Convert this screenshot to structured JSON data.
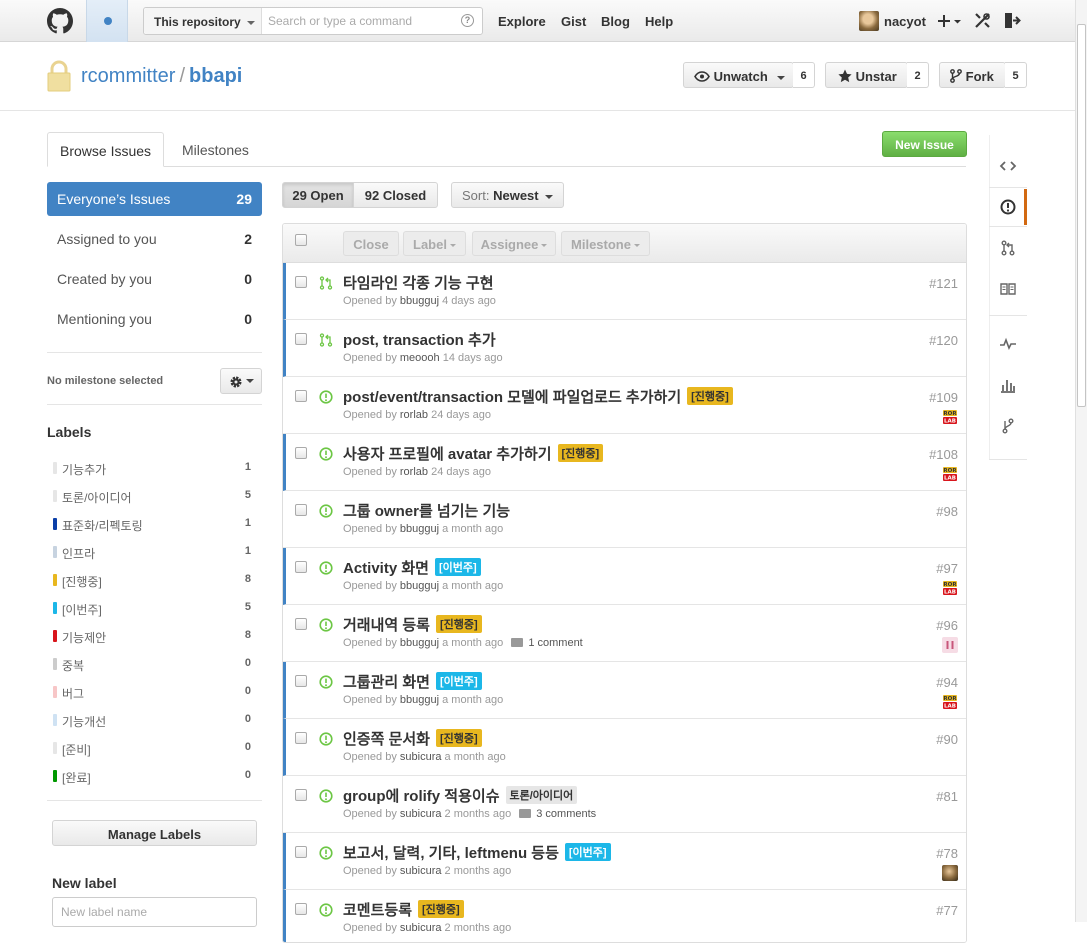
{
  "header": {
    "search_scope": "This repository",
    "search_placeholder": "Search or type a command",
    "nav": [
      "Explore",
      "Gist",
      "Blog",
      "Help"
    ],
    "username": "nacyot"
  },
  "repo": {
    "owner": "rcommitter",
    "name": "bbapi",
    "watch": {
      "label": "Unwatch",
      "count": "6"
    },
    "star": {
      "label": "Unstar",
      "count": "2"
    },
    "fork": {
      "label": "Fork",
      "count": "5"
    }
  },
  "tabs": {
    "browse": "Browse Issues",
    "milestones": "Milestones"
  },
  "new_issue": "New Issue",
  "filters": [
    {
      "label": "Everyone’s Issues",
      "count": "29"
    },
    {
      "label": "Assigned to you",
      "count": "2"
    },
    {
      "label": "Created by you",
      "count": "0"
    },
    {
      "label": "Mentioning you",
      "count": "0"
    }
  ],
  "milestone": {
    "label": "No milestone selected"
  },
  "labels": {
    "heading": "Labels",
    "items": [
      {
        "name": "기능추가",
        "count": "1",
        "color": "#e6e6e6"
      },
      {
        "name": "토론/아이디어",
        "count": "5",
        "color": "#e6e6e6"
      },
      {
        "name": "표준화/리펙토링",
        "count": "1",
        "color": "#0b3fa8"
      },
      {
        "name": "인프라",
        "count": "1",
        "color": "#c7d3e0"
      },
      {
        "name": "[진행중]",
        "count": "8",
        "color": "#e8b71f"
      },
      {
        "name": "[이번주]",
        "count": "5",
        "color": "#1cb7e8"
      },
      {
        "name": "기능제안",
        "count": "8",
        "color": "#d8151c"
      },
      {
        "name": "중복",
        "count": "0",
        "color": "#cccccc"
      },
      {
        "name": "버그",
        "count": "0",
        "color": "#f7c6c7"
      },
      {
        "name": "기능개선",
        "count": "0",
        "color": "#cfe2f3"
      },
      {
        "name": "[준비]",
        "count": "0",
        "color": "#e6e6e6"
      },
      {
        "name": "[완료]",
        "count": "0",
        "color": "#009800"
      }
    ],
    "manage": "Manage Labels",
    "new_label_heading": "New label",
    "new_label_placeholder": "New label name"
  },
  "list": {
    "open": "29 Open",
    "closed": "92 Closed",
    "sort_prefix": "Sort:",
    "sort_value": "Newest",
    "toolbar": [
      "Close",
      "Label",
      "Assignee",
      "Milestone"
    ],
    "opened_by": "Opened by"
  },
  "issues": [
    {
      "title": "타임라인 각종 기능 구현",
      "num": "#121",
      "author": "bbugguj",
      "ago": "4 days ago",
      "type": "pr",
      "bar": true,
      "tag": "",
      "tag_color": "",
      "comments": "",
      "milestone": ""
    },
    {
      "title": "post, transaction 추가",
      "num": "#120",
      "author": "meoooh",
      "ago": "14 days ago",
      "type": "pr",
      "bar": true,
      "tag": "",
      "tag_color": "",
      "comments": "",
      "milestone": ""
    },
    {
      "title": "post/event/transaction 모델에 파일업로드 추가하기",
      "num": "#109",
      "author": "rorlab",
      "ago": "24 days ago",
      "type": "issue",
      "bar": false,
      "tag": "[진행중]",
      "tag_color": "y",
      "comments": "",
      "milestone": "ROR LAB"
    },
    {
      "title": "사용자 프로필에 avatar 추가하기",
      "num": "#108",
      "author": "rorlab",
      "ago": "24 days ago",
      "type": "issue",
      "bar": true,
      "tag": "[진행중]",
      "tag_color": "y",
      "comments": "",
      "milestone": "ROR LAB"
    },
    {
      "title": "그룹 owner를 넘기는 기능",
      "num": "#98",
      "author": "bbugguj",
      "ago": "a month ago",
      "type": "issue",
      "bar": false,
      "tag": "",
      "tag_color": "",
      "comments": "",
      "milestone": ""
    },
    {
      "title": "Activity 화면",
      "num": "#97",
      "author": "bbugguj",
      "ago": "a month ago",
      "type": "issue",
      "bar": true,
      "tag": "[이번주]",
      "tag_color": "b",
      "comments": "",
      "milestone": "ROR LAB"
    },
    {
      "title": "거래내역 등록",
      "num": "#96",
      "author": "bbugguj",
      "ago": "a month ago",
      "type": "issue",
      "bar": false,
      "tag": "[진행중]",
      "tag_color": "y",
      "comments": "1 comment",
      "milestone": "pink"
    },
    {
      "title": "그룹관리 화면",
      "num": "#94",
      "author": "bbugguj",
      "ago": "a month ago",
      "type": "issue",
      "bar": true,
      "tag": "[이번주]",
      "tag_color": "b",
      "comments": "",
      "milestone": "ROR LAB"
    },
    {
      "title": "인증쪽 문서화",
      "num": "#90",
      "author": "subicura",
      "ago": "a month ago",
      "type": "issue",
      "bar": true,
      "tag": "[진행중]",
      "tag_color": "y",
      "comments": "",
      "milestone": ""
    },
    {
      "title": "group에 rolify 적용이슈",
      "num": "#81",
      "author": "subicura",
      "ago": "2 months ago",
      "type": "issue",
      "bar": false,
      "tag": "토론/아이디어",
      "tag_color": "g",
      "comments": "3 comments",
      "milestone": ""
    },
    {
      "title": "보고서, 달력, 기타, leftmenu 등등",
      "num": "#78",
      "author": "subicura",
      "ago": "2 months ago",
      "type": "issue",
      "bar": true,
      "tag": "[이번주]",
      "tag_color": "b",
      "comments": "",
      "milestone": "avatar"
    },
    {
      "title": "코멘트등록",
      "num": "#77",
      "author": "subicura",
      "ago": "2 months ago",
      "type": "issue",
      "bar": true,
      "tag": "[진행중]",
      "tag_color": "y",
      "comments": "",
      "milestone": ""
    }
  ],
  "colors": {
    "accent": "#4183c4",
    "open_green": "#6cc644",
    "rail_active": "#d26911"
  }
}
